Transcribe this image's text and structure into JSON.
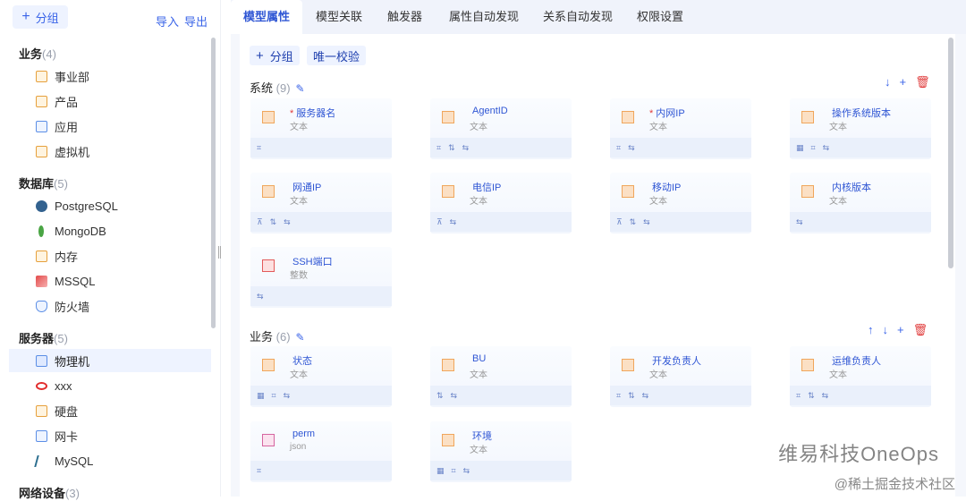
{
  "sidebar": {
    "add_group": "分组",
    "import": "导入",
    "export": "导出",
    "groups": [
      {
        "title": "业务",
        "count": "(4)",
        "items": [
          "事业部",
          "产品",
          "应用",
          "虚拟机"
        ]
      },
      {
        "title": "数据库",
        "count": "(5)",
        "items": [
          "PostgreSQL",
          "MongoDB",
          "内存",
          "MSSQL",
          "防火墙"
        ]
      },
      {
        "title": "服务器",
        "count": "(5)",
        "items": [
          "物理机",
          "xxx",
          "硬盘",
          "网卡",
          "MySQL"
        ]
      },
      {
        "title": "网络设备",
        "count": "(3)",
        "items": []
      }
    ]
  },
  "tabs": [
    "模型属性",
    "模型关联",
    "触发器",
    "属性自动发现",
    "关系自动发现",
    "权限设置"
  ],
  "toolbar": {
    "add_group": "分组",
    "unique_check": "唯一校验"
  },
  "sections": [
    {
      "title": "系统",
      "count": "(9)",
      "cards": [
        {
          "name": "服务器名",
          "type": "文本",
          "required": "*"
        },
        {
          "name": "AgentID",
          "type": "文本",
          "required": ""
        },
        {
          "name": "内网IP",
          "type": "文本",
          "required": "*"
        },
        {
          "name": "操作系统版本",
          "type": "文本",
          "required": ""
        },
        {
          "name": "网通IP",
          "type": "文本",
          "required": ""
        },
        {
          "name": "电信IP",
          "type": "文本",
          "required": ""
        },
        {
          "name": "移动IP",
          "type": "文本",
          "required": ""
        },
        {
          "name": "内核版本",
          "type": "文本",
          "required": ""
        },
        {
          "name": "SSH端口",
          "type": "整数",
          "required": ""
        }
      ]
    },
    {
      "title": "业务",
      "count": "(6)",
      "cards": [
        {
          "name": "状态",
          "type": "文本",
          "required": ""
        },
        {
          "name": "BU",
          "type": "文本",
          "required": ""
        },
        {
          "name": "开发负责人",
          "type": "文本",
          "required": ""
        },
        {
          "name": "运维负责人",
          "type": "文本",
          "required": ""
        },
        {
          "name": "perm",
          "type": "json",
          "required": ""
        },
        {
          "name": "环境",
          "type": "文本",
          "required": ""
        }
      ]
    }
  ],
  "watermark": {
    "main": "维易科技OneOps",
    "sub": "@稀土掘金技术社区"
  }
}
